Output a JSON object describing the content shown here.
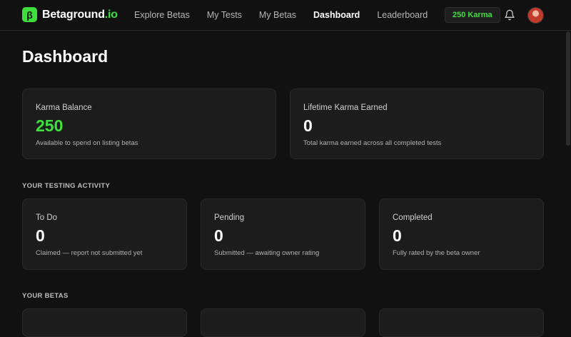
{
  "header": {
    "logo_mark": "β",
    "brand_name": "Betaground",
    "brand_tld": ".io",
    "nav": [
      {
        "label": "Explore Betas",
        "active": false
      },
      {
        "label": "My Tests",
        "active": false
      },
      {
        "label": "My Betas",
        "active": false
      },
      {
        "label": "Dashboard",
        "active": true
      },
      {
        "label": "Leaderboard",
        "active": false
      }
    ],
    "karma_badge": "250 Karma",
    "icons": {
      "notifications": "bell-icon",
      "profile": "avatar"
    }
  },
  "page": {
    "title": "Dashboard"
  },
  "karma": {
    "balance": {
      "label": "Karma Balance",
      "value": "250",
      "desc": "Available to spend on listing betas",
      "color": "#3ee03e"
    },
    "lifetime": {
      "label": "Lifetime Karma Earned",
      "value": "0",
      "desc": "Total karma earned across all completed tests"
    }
  },
  "activity": {
    "title": "YOUR TESTING ACTIVITY",
    "cards": [
      {
        "label": "To Do",
        "value": "0",
        "desc": "Claimed — report not submitted yet"
      },
      {
        "label": "Pending",
        "value": "0",
        "desc": "Submitted — awaiting owner rating"
      },
      {
        "label": "Completed",
        "value": "0",
        "desc": "Fully rated by the beta owner"
      }
    ]
  },
  "betas": {
    "title": "YOUR BETAS"
  },
  "colors": {
    "accent": "#3ee03e",
    "background": "#111111",
    "card": "#1c1c1c"
  }
}
